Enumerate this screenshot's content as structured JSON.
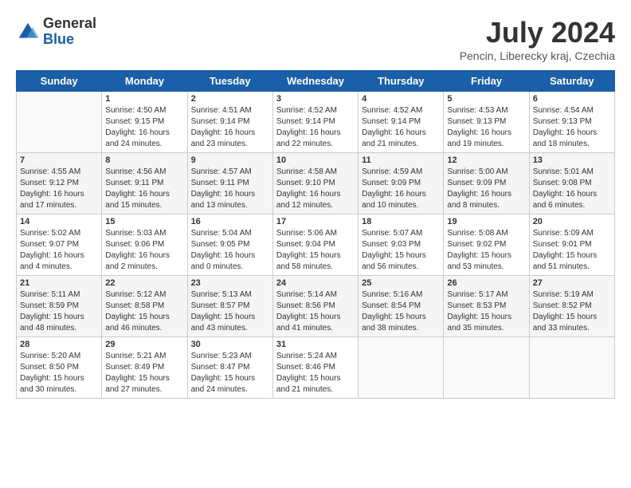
{
  "header": {
    "logo_general": "General",
    "logo_blue": "Blue",
    "title": "July 2024",
    "location": "Pencin, Liberecky kraj, Czechia"
  },
  "days_of_week": [
    "Sunday",
    "Monday",
    "Tuesday",
    "Wednesday",
    "Thursday",
    "Friday",
    "Saturday"
  ],
  "weeks": [
    {
      "days": [
        {
          "num": "",
          "sunrise": "",
          "sunset": "",
          "daylight": ""
        },
        {
          "num": "1",
          "sunrise": "Sunrise: 4:50 AM",
          "sunset": "Sunset: 9:15 PM",
          "daylight": "Daylight: 16 hours and 24 minutes."
        },
        {
          "num": "2",
          "sunrise": "Sunrise: 4:51 AM",
          "sunset": "Sunset: 9:14 PM",
          "daylight": "Daylight: 16 hours and 23 minutes."
        },
        {
          "num": "3",
          "sunrise": "Sunrise: 4:52 AM",
          "sunset": "Sunset: 9:14 PM",
          "daylight": "Daylight: 16 hours and 22 minutes."
        },
        {
          "num": "4",
          "sunrise": "Sunrise: 4:52 AM",
          "sunset": "Sunset: 9:14 PM",
          "daylight": "Daylight: 16 hours and 21 minutes."
        },
        {
          "num": "5",
          "sunrise": "Sunrise: 4:53 AM",
          "sunset": "Sunset: 9:13 PM",
          "daylight": "Daylight: 16 hours and 19 minutes."
        },
        {
          "num": "6",
          "sunrise": "Sunrise: 4:54 AM",
          "sunset": "Sunset: 9:13 PM",
          "daylight": "Daylight: 16 hours and 18 minutes."
        }
      ]
    },
    {
      "days": [
        {
          "num": "7",
          "sunrise": "Sunrise: 4:55 AM",
          "sunset": "Sunset: 9:12 PM",
          "daylight": "Daylight: 16 hours and 17 minutes."
        },
        {
          "num": "8",
          "sunrise": "Sunrise: 4:56 AM",
          "sunset": "Sunset: 9:11 PM",
          "daylight": "Daylight: 16 hours and 15 minutes."
        },
        {
          "num": "9",
          "sunrise": "Sunrise: 4:57 AM",
          "sunset": "Sunset: 9:11 PM",
          "daylight": "Daylight: 16 hours and 13 minutes."
        },
        {
          "num": "10",
          "sunrise": "Sunrise: 4:58 AM",
          "sunset": "Sunset: 9:10 PM",
          "daylight": "Daylight: 16 hours and 12 minutes."
        },
        {
          "num": "11",
          "sunrise": "Sunrise: 4:59 AM",
          "sunset": "Sunset: 9:09 PM",
          "daylight": "Daylight: 16 hours and 10 minutes."
        },
        {
          "num": "12",
          "sunrise": "Sunrise: 5:00 AM",
          "sunset": "Sunset: 9:09 PM",
          "daylight": "Daylight: 16 hours and 8 minutes."
        },
        {
          "num": "13",
          "sunrise": "Sunrise: 5:01 AM",
          "sunset": "Sunset: 9:08 PM",
          "daylight": "Daylight: 16 hours and 6 minutes."
        }
      ]
    },
    {
      "days": [
        {
          "num": "14",
          "sunrise": "Sunrise: 5:02 AM",
          "sunset": "Sunset: 9:07 PM",
          "daylight": "Daylight: 16 hours and 4 minutes."
        },
        {
          "num": "15",
          "sunrise": "Sunrise: 5:03 AM",
          "sunset": "Sunset: 9:06 PM",
          "daylight": "Daylight: 16 hours and 2 minutes."
        },
        {
          "num": "16",
          "sunrise": "Sunrise: 5:04 AM",
          "sunset": "Sunset: 9:05 PM",
          "daylight": "Daylight: 16 hours and 0 minutes."
        },
        {
          "num": "17",
          "sunrise": "Sunrise: 5:06 AM",
          "sunset": "Sunset: 9:04 PM",
          "daylight": "Daylight: 15 hours and 58 minutes."
        },
        {
          "num": "18",
          "sunrise": "Sunrise: 5:07 AM",
          "sunset": "Sunset: 9:03 PM",
          "daylight": "Daylight: 15 hours and 56 minutes."
        },
        {
          "num": "19",
          "sunrise": "Sunrise: 5:08 AM",
          "sunset": "Sunset: 9:02 PM",
          "daylight": "Daylight: 15 hours and 53 minutes."
        },
        {
          "num": "20",
          "sunrise": "Sunrise: 5:09 AM",
          "sunset": "Sunset: 9:01 PM",
          "daylight": "Daylight: 15 hours and 51 minutes."
        }
      ]
    },
    {
      "days": [
        {
          "num": "21",
          "sunrise": "Sunrise: 5:11 AM",
          "sunset": "Sunset: 8:59 PM",
          "daylight": "Daylight: 15 hours and 48 minutes."
        },
        {
          "num": "22",
          "sunrise": "Sunrise: 5:12 AM",
          "sunset": "Sunset: 8:58 PM",
          "daylight": "Daylight: 15 hours and 46 minutes."
        },
        {
          "num": "23",
          "sunrise": "Sunrise: 5:13 AM",
          "sunset": "Sunset: 8:57 PM",
          "daylight": "Daylight: 15 hours and 43 minutes."
        },
        {
          "num": "24",
          "sunrise": "Sunrise: 5:14 AM",
          "sunset": "Sunset: 8:56 PM",
          "daylight": "Daylight: 15 hours and 41 minutes."
        },
        {
          "num": "25",
          "sunrise": "Sunrise: 5:16 AM",
          "sunset": "Sunset: 8:54 PM",
          "daylight": "Daylight: 15 hours and 38 minutes."
        },
        {
          "num": "26",
          "sunrise": "Sunrise: 5:17 AM",
          "sunset": "Sunset: 8:53 PM",
          "daylight": "Daylight: 15 hours and 35 minutes."
        },
        {
          "num": "27",
          "sunrise": "Sunrise: 5:19 AM",
          "sunset": "Sunset: 8:52 PM",
          "daylight": "Daylight: 15 hours and 33 minutes."
        }
      ]
    },
    {
      "days": [
        {
          "num": "28",
          "sunrise": "Sunrise: 5:20 AM",
          "sunset": "Sunset: 8:50 PM",
          "daylight": "Daylight: 15 hours and 30 minutes."
        },
        {
          "num": "29",
          "sunrise": "Sunrise: 5:21 AM",
          "sunset": "Sunset: 8:49 PM",
          "daylight": "Daylight: 15 hours and 27 minutes."
        },
        {
          "num": "30",
          "sunrise": "Sunrise: 5:23 AM",
          "sunset": "Sunset: 8:47 PM",
          "daylight": "Daylight: 15 hours and 24 minutes."
        },
        {
          "num": "31",
          "sunrise": "Sunrise: 5:24 AM",
          "sunset": "Sunset: 8:46 PM",
          "daylight": "Daylight: 15 hours and 21 minutes."
        },
        {
          "num": "",
          "sunrise": "",
          "sunset": "",
          "daylight": ""
        },
        {
          "num": "",
          "sunrise": "",
          "sunset": "",
          "daylight": ""
        },
        {
          "num": "",
          "sunrise": "",
          "sunset": "",
          "daylight": ""
        }
      ]
    }
  ]
}
